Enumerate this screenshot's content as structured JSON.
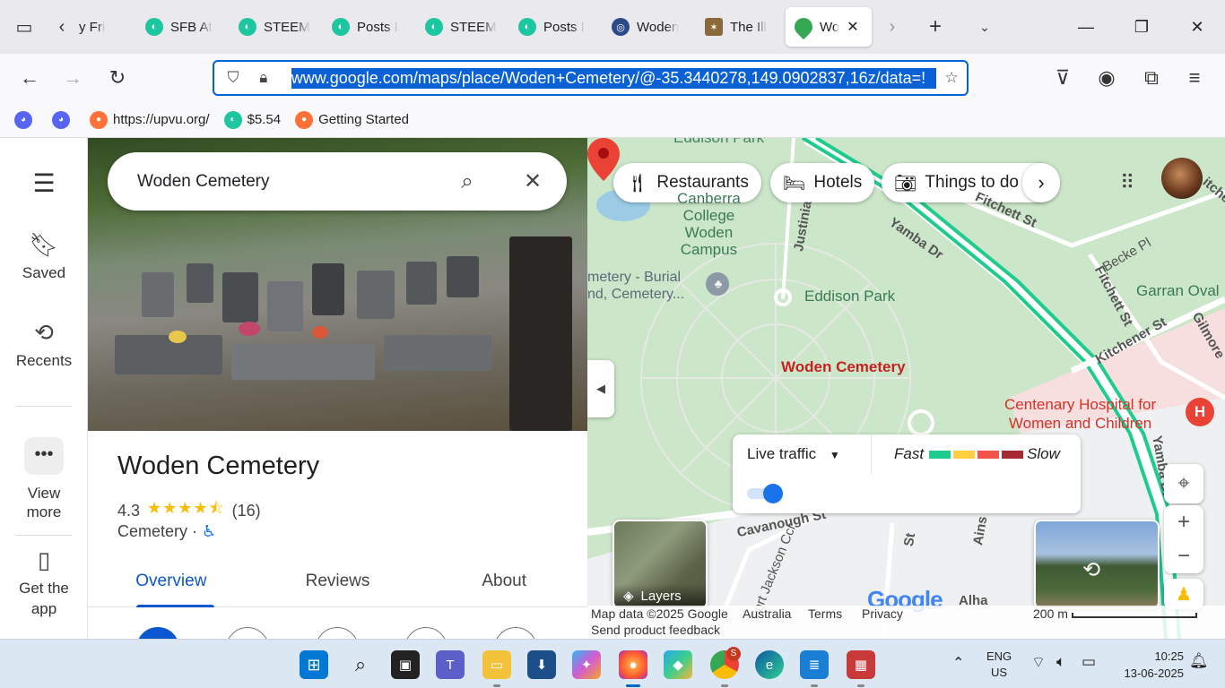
{
  "browser": {
    "tabs": [
      {
        "title": "y Fri",
        "color": "#4a3c8c",
        "active": false
      },
      {
        "title": "SFB At",
        "color": "#1ec6a0",
        "active": false
      },
      {
        "title": "STEEM",
        "color": "#1ec6a0",
        "active": false
      },
      {
        "title": "Posts I",
        "color": "#1ec6a0",
        "active": false
      },
      {
        "title": "STEEM",
        "color": "#1ec6a0",
        "active": false
      },
      {
        "title": "Posts I",
        "color": "#1ec6a0",
        "active": false
      },
      {
        "title": "Woden",
        "color": "#2c4a8a",
        "active": false
      },
      {
        "title": "The Ill",
        "color": "#8a6a3a",
        "active": false
      },
      {
        "title": "Wo",
        "color": "#34a853",
        "active": true
      }
    ],
    "url": "www.google.com/maps/place/Woden+Cemetery/@-35.3440278,149.0902837,16z/data=!",
    "bookmarks": [
      {
        "label": "",
        "color": "#5865f2"
      },
      {
        "label": "",
        "color": "#5865f2"
      },
      {
        "label": "https://upvu.org/",
        "color": "#ff7139"
      },
      {
        "label": "$5.54",
        "color": "#1ec6a0"
      },
      {
        "label": "Getting Started",
        "color": "#ff7139"
      }
    ]
  },
  "rail": {
    "saved": "Saved",
    "recents": "Recents",
    "view_more_1": "View",
    "view_more_2": "more",
    "get_app_1": "Get the",
    "get_app_2": "app"
  },
  "panel": {
    "search_query": "Woden Cemetery",
    "title": "Woden Cemetery",
    "rating": "4.3",
    "stars": "★★★★⯪",
    "reviews_count": "(16)",
    "category": "Cemetery",
    "tabs": [
      "Overview",
      "Reviews",
      "About"
    ]
  },
  "map": {
    "chips": [
      {
        "label": "Restaurants",
        "icon": "fork-knife-icon"
      },
      {
        "label": "Hotels",
        "icon": "bed-icon"
      },
      {
        "label": "Things to do",
        "icon": "camera-icon"
      }
    ],
    "labels": {
      "eddison_park_top": "Eddison Park",
      "college_1": "Canberra",
      "college_2": "College",
      "college_3": "Woden",
      "college_4": "Campus",
      "burial_1": "metery - Burial",
      "burial_2": "nd, Cemetery...",
      "eddison_park": "Eddison Park",
      "garran_oval": "Garran Oval",
      "place_pin": "Woden Cemetery",
      "hospital_1": "Centenary Hospital for",
      "hospital_2": "Women and Children",
      "hospital_letter": "H"
    },
    "streets": {
      "yamba_dr": "Yamba Dr",
      "yamba_dr_2": "Yamba Dr",
      "justinian": "Justinia",
      "fitchett_st": "Fitchett St",
      "fitchett_st_2": "Fitchett St",
      "becke_pl": "Becke Pl",
      "kitchener_st": "Kitchener St",
      "gilmore": "Gilmore",
      "cavanough_st": "Cavanough St",
      "port_jackson": "Port Jackson Ccr",
      "st_small": "St",
      "ains": "Ains",
      "alha": "Alha",
      "mitchell": "itche"
    },
    "traffic": {
      "label": "Live traffic",
      "fast": "Fast",
      "slow": "Slow",
      "colors": [
        "#1fcc8d",
        "#ffcf40",
        "#f2544b",
        "#a62931"
      ],
      "toggle_on": true
    },
    "layers_label": "Layers",
    "google_logo": "Google",
    "footer": {
      "data": "Map data ©2025 Google",
      "country": "Australia",
      "terms": "Terms",
      "privacy": "Privacy",
      "feedback": "Send product feedback",
      "scale": "200 m"
    },
    "zoom_in": "+",
    "zoom_out": "−"
  },
  "taskbar": {
    "lang_1": "ENG",
    "lang_2": "US",
    "time": "10:25",
    "date": "13-06-2025",
    "apps": [
      "start-icon",
      "search-icon",
      "task-view-icon",
      "teams-icon",
      "file-explorer-icon",
      "downloads-icon",
      "copilot-icon",
      "firefox-icon",
      "m365-icon",
      "chrome-icon",
      "edge-icon",
      "notepad-icon",
      "image-app-icon"
    ]
  }
}
